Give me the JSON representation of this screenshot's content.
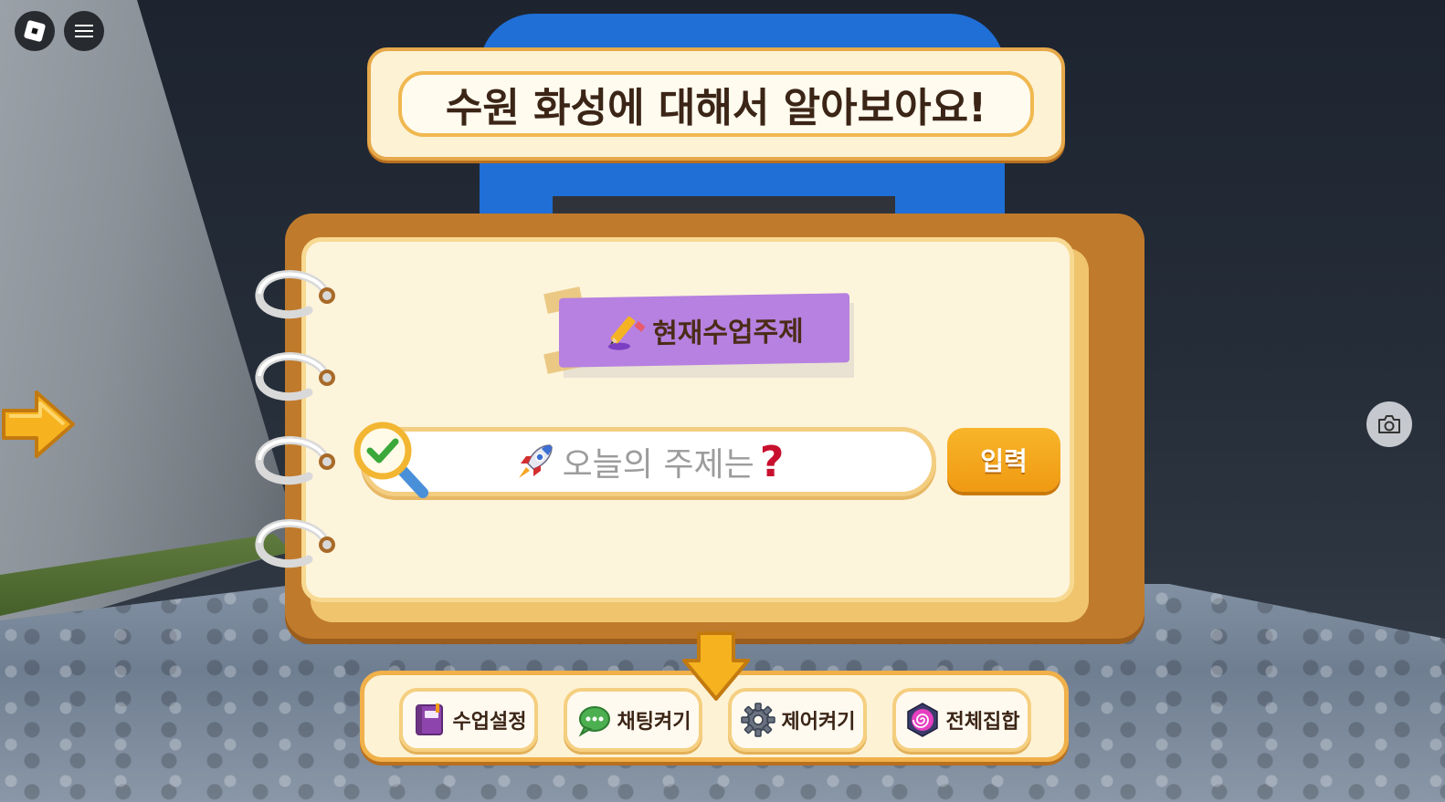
{
  "title": "수원 화성에 대해서 알아보아요!",
  "topic_badge": "현재수업주제",
  "search": {
    "placeholder": "오늘의 주제는"
  },
  "input_button": "입력",
  "toolbar": [
    {
      "label": "수업설정",
      "icon": "book-icon"
    },
    {
      "label": "채팅켜기",
      "icon": "chat-bubble-icon"
    },
    {
      "label": "제어켜기",
      "icon": "gear-icon"
    },
    {
      "label": "전체집합",
      "icon": "swirl-icon"
    }
  ],
  "colors": {
    "accent": "#f0b04a",
    "badge": "#b681e0",
    "button": "#f5a61c",
    "notebook": "#c07a2c"
  }
}
